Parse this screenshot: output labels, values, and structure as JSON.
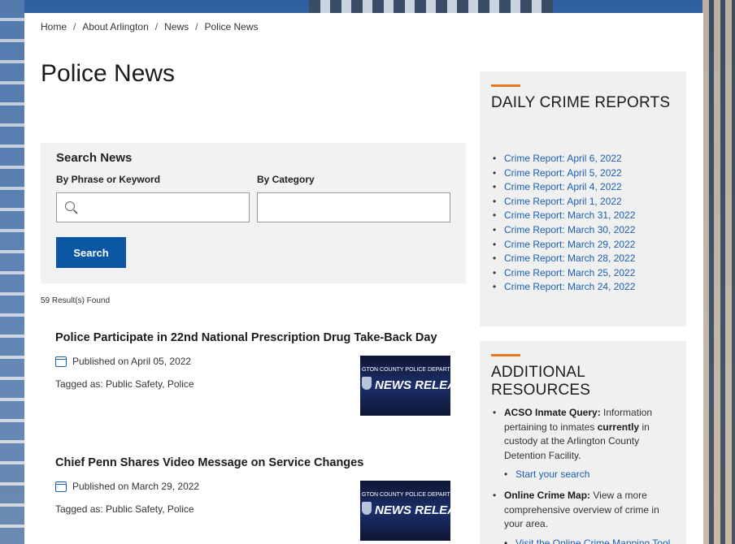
{
  "breadcrumb": [
    "Home",
    "About Arlington",
    "News",
    "Police News"
  ],
  "page_title": "Police News",
  "search": {
    "title": "Search News",
    "keyword_label": "By Phrase or Keyword",
    "category_label": "By Category",
    "keyword_value": "",
    "category_value": "",
    "button_label": "Search"
  },
  "results_count": "59 Result(s) Found",
  "articles": [
    {
      "title": "Police Participate in 22nd National Prescription Drug Take-Back Day",
      "published": "Published on April 05, 2022",
      "tags": "Tagged as: Public Safety, Police",
      "thumb_header": "GTON COUNTY POLICE DEPART",
      "thumb_title": "NEWS RELEA"
    },
    {
      "title": "Chief Penn Shares Video Message on Service Changes",
      "published": "Published on March 29, 2022",
      "tags": "Tagged as: Public Safety, Police",
      "thumb_header": "GTON COUNTY POLICE DEPART",
      "thumb_title": "NEWS RELEA"
    }
  ],
  "daily_crime": {
    "title": "DAILY CRIME REPORTS",
    "items": [
      "Crime Report: April 6, 2022",
      "Crime Report: April 5, 2022",
      "Crime Report: April 4, 2022",
      "Crime Report: April 1, 2022",
      "Crime Report: March 31, 2022",
      "Crime Report: March 30, 2022",
      "Crime Report: March 29, 2022",
      "Crime Report: March 28, 2022",
      "Crime Report: March 25, 2022",
      "Crime Report: March 24, 2022"
    ]
  },
  "resources": {
    "title": "ADDITIONAL RESOURCES",
    "inmate_label": "ACSO Inmate Query:",
    "inmate_text_1": "Information pertaining to inmates",
    "inmate_bold": "currently",
    "inmate_text_2": "in custody at the Arlington County Detention Facility.",
    "inmate_link": "Start your search",
    "map_label": "Online Crime Map:",
    "map_text": "View a more comprehensive overview of crime in your area.",
    "map_link": "Visit the Online Crime Mapping Tool"
  },
  "colors": {
    "accent": "#e87722",
    "link": "#1a5fb4",
    "button": "#0b57a4"
  }
}
